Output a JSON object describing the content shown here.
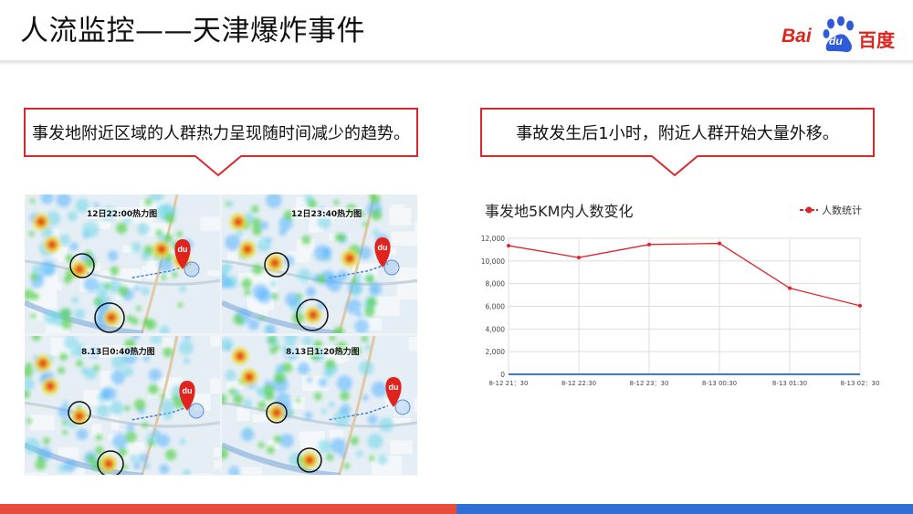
{
  "slide": {
    "title": "人流监控——天津爆炸事件"
  },
  "logo": {
    "bai": "Bai",
    "du": "du",
    "cn": "百度"
  },
  "callouts": {
    "left": "事发地附近区域的人群热力呈现随时间减少的趋势。",
    "right": "事故发生后1小时，附近人群开始大量外移。"
  },
  "heatmaps": [
    {
      "label": "12日22:00热力图",
      "marker": "du"
    },
    {
      "label": "12日23:40热力图",
      "marker": "du"
    },
    {
      "label": "8.13日0:40热力图",
      "marker": "du"
    },
    {
      "label": "8.13日1:20热力图",
      "marker": "du"
    }
  ],
  "chart": {
    "title": "事发地5KM内人数变化",
    "legend": "人数统计"
  },
  "chart_data": {
    "type": "line",
    "title": "事发地5KM内人数变化",
    "categories": [
      "8-12 21：30",
      "8-12 22:30",
      "8-12 23：30",
      "8-13 00:30",
      "8-13 01:30",
      "8-13 02：30"
    ],
    "series": [
      {
        "name": "人数统计",
        "values": [
          11350,
          10300,
          11450,
          11550,
          7600,
          6050
        ]
      }
    ],
    "ylim": [
      0,
      12000
    ],
    "yticks": [
      "0",
      "2,000",
      "4,000",
      "6,000",
      "8,000",
      "10,000",
      "12,000"
    ],
    "ytick_values": [
      0,
      2000,
      4000,
      6000,
      8000,
      10000,
      12000
    ],
    "grid": true,
    "legend_position": "top-right",
    "line_color": "#e0232a"
  },
  "colors": {
    "accent_red": "#d9282d",
    "footer_red": "#e74c3c",
    "footer_blue": "#2f6fd6"
  }
}
